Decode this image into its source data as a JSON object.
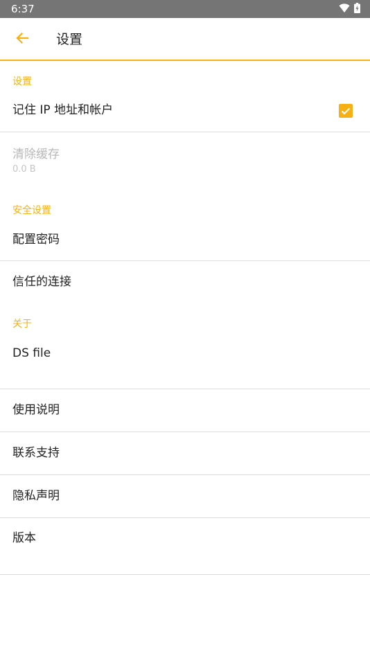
{
  "status_bar": {
    "time": "6:37",
    "wifi_icon": "wifi-icon",
    "battery_icon": "battery-charging-icon"
  },
  "app_bar": {
    "back_icon": "arrow-back-icon",
    "title": "设置"
  },
  "colors": {
    "accent": "#f7b013",
    "status_bar": "#757575",
    "text_primary": "#212121",
    "text_disabled": "#b8b8b8",
    "divider": "#dcdcdc"
  },
  "sections": {
    "settings": {
      "header": "设置",
      "remember_ip": {
        "title": "记住 IP 地址和帐户",
        "checked": true
      },
      "clear_cache": {
        "title": "清除缓存",
        "summary": "0.0 B",
        "enabled": false
      }
    },
    "security": {
      "header": "安全设置",
      "configure_password": {
        "title": "配置密码"
      },
      "trusted_connections": {
        "title": "信任的连接"
      }
    },
    "about": {
      "header": "关于",
      "app_name": {
        "title": "DS file"
      },
      "instructions": {
        "title": "使用说明"
      },
      "contact_support": {
        "title": "联系支持"
      },
      "privacy_statement": {
        "title": "隐私声明"
      },
      "version": {
        "title": "版本"
      }
    }
  }
}
